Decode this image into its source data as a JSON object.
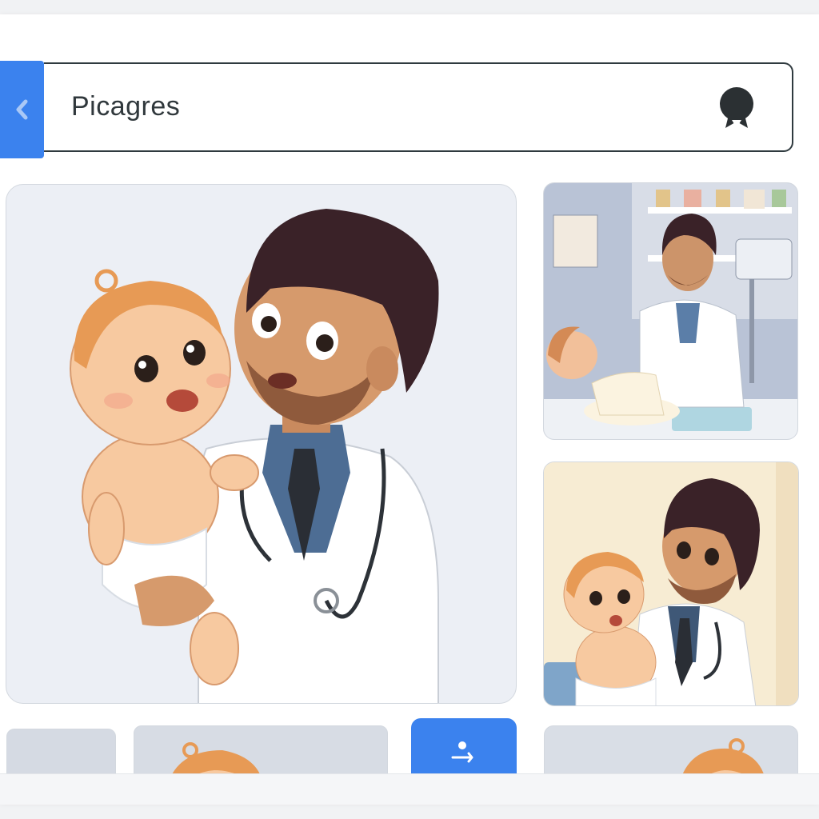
{
  "search": {
    "query": "Picagres"
  },
  "icons": {
    "back": "chevron-left-icon",
    "search_action": "badge-icon",
    "fab": "user-arrow-icon"
  },
  "colors": {
    "accent": "#3b82ee",
    "search_border": "#2f3a3f",
    "text": "#30383c"
  }
}
